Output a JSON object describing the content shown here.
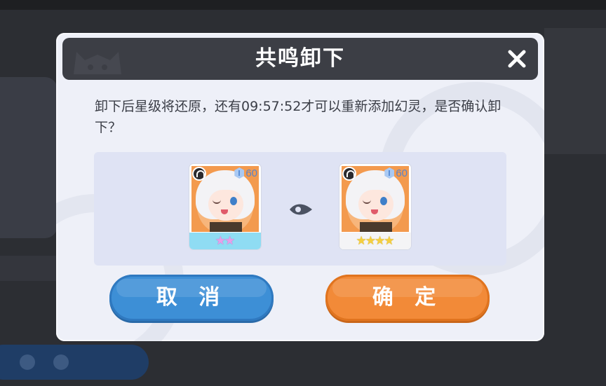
{
  "dialog": {
    "title": "共鸣卸下",
    "message": "卸下后星级将还原，还有09:57:52才可以重新添加幻灵，是否确认卸下？",
    "close_icon": "close-icon",
    "cancel_label": "取 消",
    "confirm_label": "确 定"
  },
  "before_card": {
    "level": "60",
    "stars": 2,
    "star_color": "#e7a0e8",
    "element_icon": "element-badge-icon"
  },
  "after_card": {
    "level": "60",
    "stars": 4,
    "star_color": "#f5cf3e",
    "element_icon": "element-badge-icon"
  },
  "arrow_icon": "arrow-right-icon",
  "colors": {
    "cancel": "#3d8fd6",
    "confirm": "#f28a38",
    "header": "#3c3e45"
  }
}
